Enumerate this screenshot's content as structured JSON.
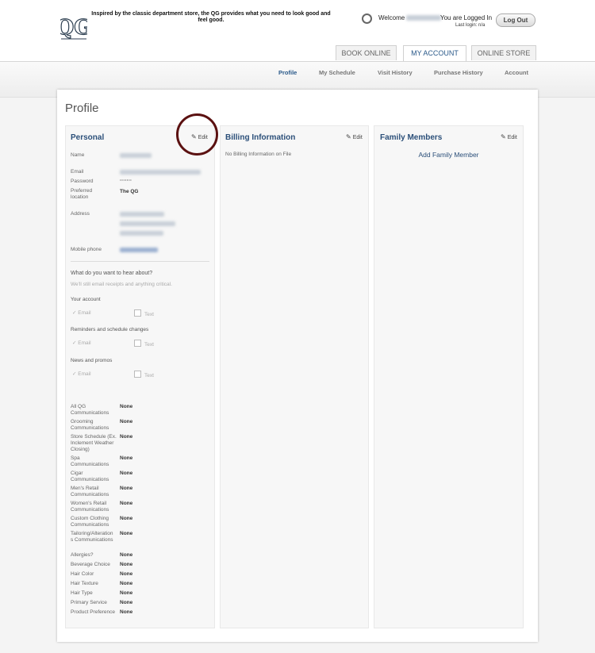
{
  "header": {
    "logo_text": "QG",
    "tagline": "Inspired by the classic department store, the QG provides what you need to look good and feel good.",
    "welcome": "Welcome",
    "logged_in": "You are Logged In",
    "last_login": "Last login: n/a",
    "logout_label": "Log Out"
  },
  "tabs": [
    {
      "label": "BOOK ONLINE",
      "active": false
    },
    {
      "label": "MY ACCOUNT",
      "active": true
    },
    {
      "label": "ONLINE STORE",
      "active": false
    }
  ],
  "subnav": [
    {
      "label": "Profile",
      "active": true
    },
    {
      "label": "My Schedule",
      "active": false
    },
    {
      "label": "Visit History",
      "active": false
    },
    {
      "label": "Purchase History",
      "active": false
    },
    {
      "label": "Account",
      "active": false
    }
  ],
  "page_title": "Profile",
  "edit_label": "Edit",
  "personal": {
    "title": "Personal",
    "fields": {
      "name": "Name",
      "email": "Email",
      "password": "Password",
      "password_value": "·······",
      "preferred": "Preferred location",
      "preferred_value": "The QG",
      "address": "Address",
      "mobile": "Mobile phone"
    },
    "notify_question": "What do you want to hear about?",
    "notify_sub": "We'll still email receipts and anything critical.",
    "groups": [
      {
        "label": "Your account",
        "email": "Email",
        "text": "Text"
      },
      {
        "label": "Reminders and schedule changes",
        "email": "Email",
        "text": "Text"
      },
      {
        "label": "News and promos",
        "email": "Email",
        "text": "Text"
      }
    ],
    "prefs": [
      {
        "label": "All QG Communications",
        "value": "None"
      },
      {
        "label": "Grooming Communications",
        "value": "None"
      },
      {
        "label": "Store Schedule (Ex. Inclement Weather Closing)",
        "value": "None"
      },
      {
        "label": "Spa Communications",
        "value": "None"
      },
      {
        "label": "Cigar Communications",
        "value": "None"
      },
      {
        "label": "Men's Retail Communications",
        "value": "None"
      },
      {
        "label": "Women's Retail Communications",
        "value": "None"
      },
      {
        "label": "Custom Clothing Communications",
        "value": "None"
      },
      {
        "label": "Tailoring/Alterations Communications",
        "value": "None"
      },
      {
        "label": "Allergies?",
        "value": "None"
      },
      {
        "label": "Beverage Choice",
        "value": "None"
      },
      {
        "label": "Hair Color",
        "value": "None"
      },
      {
        "label": "Hair Texture",
        "value": "None"
      },
      {
        "label": "Hair Type",
        "value": "None"
      },
      {
        "label": "Primary Service",
        "value": "None"
      },
      {
        "label": "Product Preference",
        "value": "None"
      }
    ]
  },
  "billing": {
    "title": "Billing Information",
    "empty": "No Billing Information on File"
  },
  "family": {
    "title": "Family Members",
    "add": "Add Family Member"
  }
}
